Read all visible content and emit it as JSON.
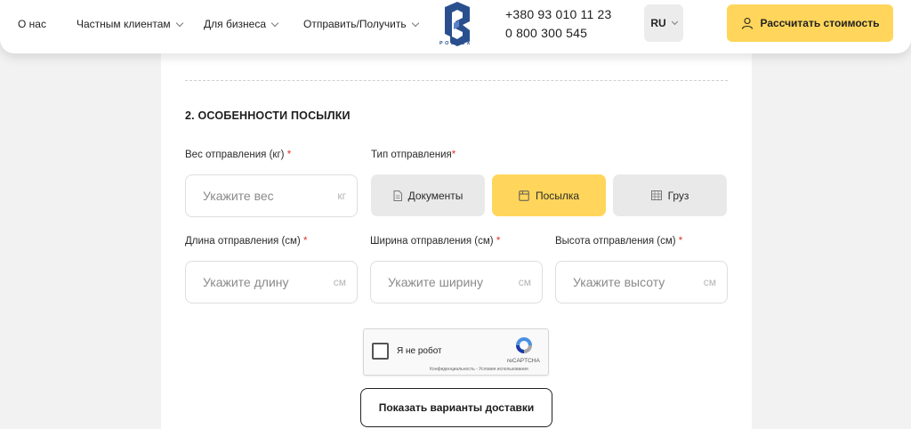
{
  "header": {
    "nav": [
      {
        "label": "О нас",
        "has_dropdown": false
      },
      {
        "label": "Частным клиентам",
        "has_dropdown": true
      },
      {
        "label": "Для бизнеса",
        "has_dropdown": true
      },
      {
        "label": "Отправить/Получить",
        "has_dropdown": true
      }
    ],
    "logo_text": "POSTEX",
    "phones": [
      "+380 93 010 11 23",
      "0 800 300 545"
    ],
    "language": "RU",
    "calc_button": "Рассчитать стоимость"
  },
  "form": {
    "section_title": "2. ОСОБЕННОСТИ ПОСЫЛКИ",
    "weight": {
      "label": "Вес отправления (кг)",
      "required": "*",
      "placeholder": "Укажите вес",
      "unit": "кг"
    },
    "type": {
      "label": "Тип отправления",
      "required": "*",
      "options": [
        {
          "label": "Документы",
          "icon": "document-icon",
          "selected": false
        },
        {
          "label": "Посылка",
          "icon": "parcel-icon",
          "selected": true
        },
        {
          "label": "Груз",
          "icon": "cargo-icon",
          "selected": false
        }
      ]
    },
    "length": {
      "label": "Длина отправления (см)",
      "required": "*",
      "placeholder": "Укажите длину",
      "unit": "см"
    },
    "width": {
      "label": "Ширина отправления (см)",
      "required": "*",
      "placeholder": "Укажите ширину",
      "unit": "см"
    },
    "height": {
      "label": "Высота отправления (см)",
      "required": "*",
      "placeholder": "Укажите высоту",
      "unit": "см"
    },
    "captcha": {
      "label": "Я не робот",
      "brand": "reCAPTCHA",
      "links": "Конфиденциальность - Условия использования"
    },
    "submit": "Показать варианты доставки"
  },
  "colors": {
    "accent": "#ffd65b",
    "required": "#e0332b",
    "logo": "#2a4f8e"
  }
}
